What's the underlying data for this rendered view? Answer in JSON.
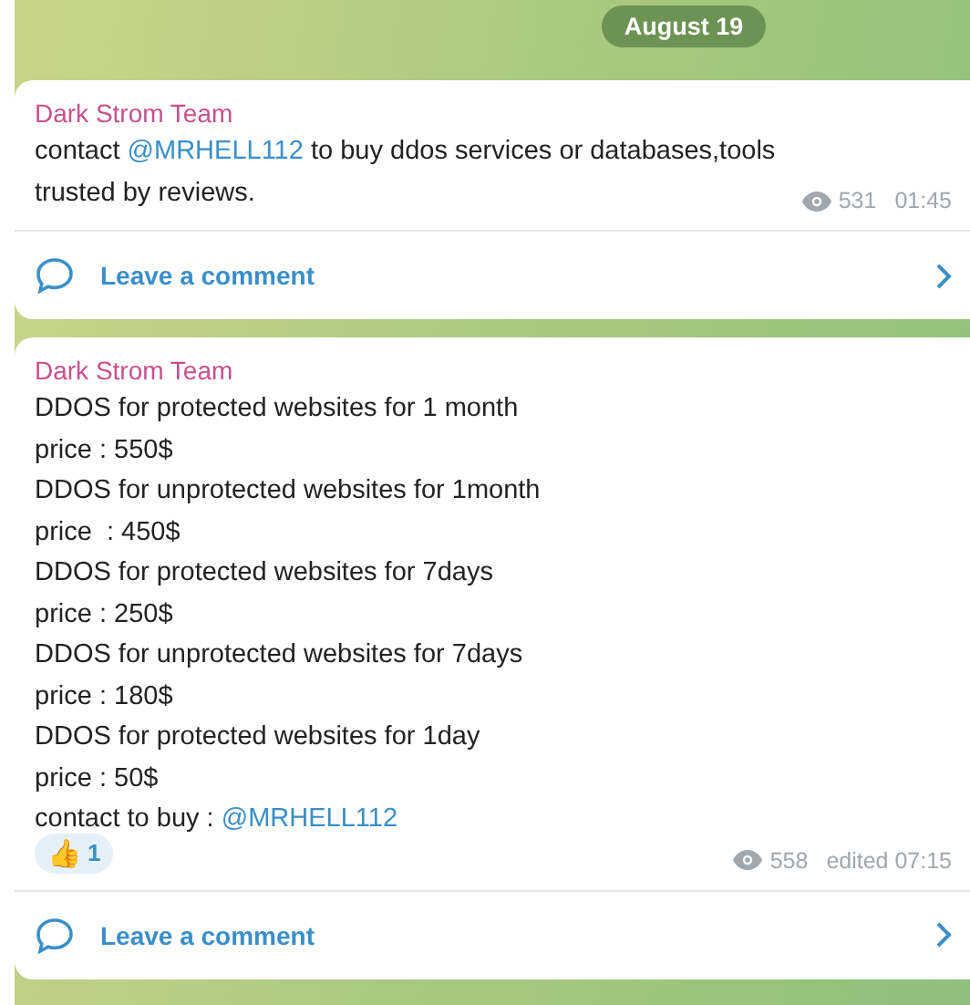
{
  "date_badge": "August 19",
  "posts": [
    {
      "author": "Dark Strom Team",
      "text": [
        {
          "kind": "plain",
          "text": "contact "
        },
        {
          "kind": "mention",
          "text": "@MRHELL112"
        },
        {
          "kind": "plain",
          "text": " to buy ddos services or databases,tools trusted by reviews."
        }
      ],
      "views": "531",
      "time": "01:45",
      "comment_label": "Leave a comment"
    },
    {
      "author": "Dark Strom Team",
      "text": [
        {
          "kind": "plain",
          "text": "DDOS for protected websites for 1 month\nprice : 550$\nDDOS for unprotected websites for 1month\nprice  : 450$\nDDOS for protected websites for 7days\nprice : 250$\nDDOS for unprotected websites for 7days\nprice : 180$\nDDOS for protected websites for 1day\nprice : 50$\ncontact to buy : "
        },
        {
          "kind": "mention",
          "text": "@MRHELL112"
        }
      ],
      "reactions": [
        {
          "emoji": "👍",
          "count": "1"
        }
      ],
      "views": "558",
      "time": "edited 07:15",
      "comment_label": "Leave a comment"
    }
  ]
}
